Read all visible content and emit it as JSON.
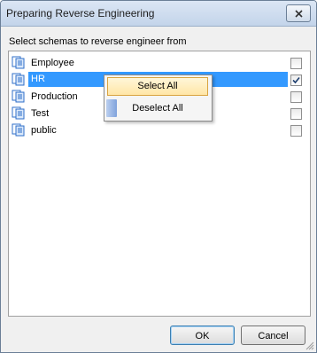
{
  "window": {
    "title": "Preparing Reverse Engineering"
  },
  "prompt": "Select schemas to reverse engineer from",
  "schemas": [
    {
      "label": "Employee",
      "checked": false,
      "selected": false
    },
    {
      "label": "HR",
      "checked": true,
      "selected": true
    },
    {
      "label": "Production",
      "checked": false,
      "selected": false
    },
    {
      "label": "Test",
      "checked": false,
      "selected": false
    },
    {
      "label": "public",
      "checked": false,
      "selected": false
    }
  ],
  "context_menu": {
    "select_all": "Select All",
    "deselect_all": "Deselect All"
  },
  "buttons": {
    "ok": "OK",
    "cancel": "Cancel"
  },
  "colors": {
    "selection": "#3399ff",
    "title_bar": "#c3d4ea",
    "menu_highlight": "#ffe6a6"
  }
}
